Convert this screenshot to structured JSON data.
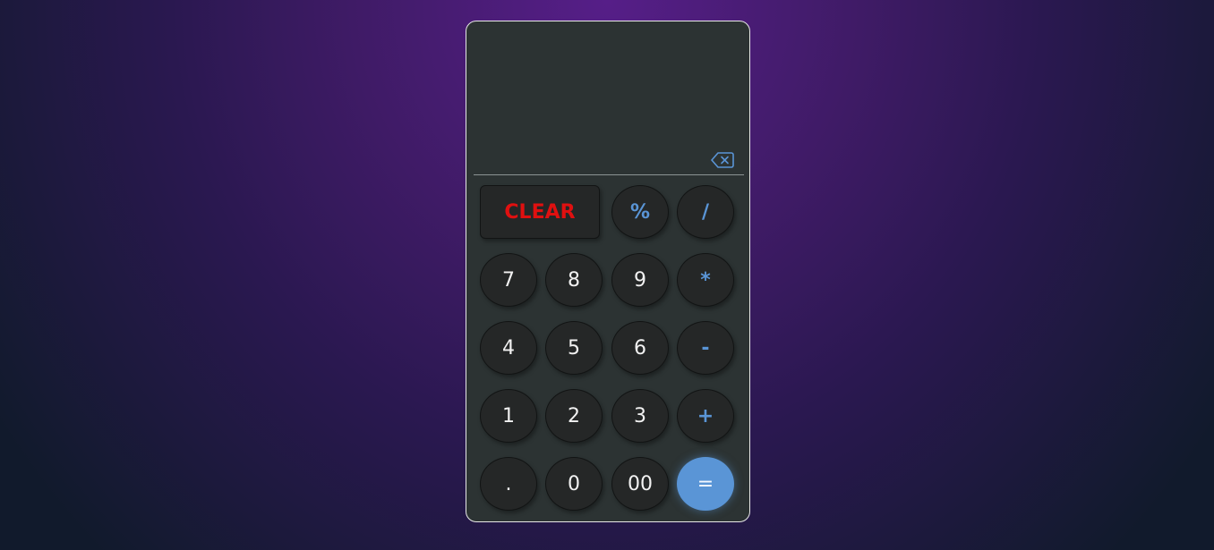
{
  "display": {
    "value": "",
    "backspace_icon": "backspace-icon"
  },
  "keys": {
    "clear": "CLEAR",
    "percent": "%",
    "divide": "/",
    "seven": "7",
    "eight": "8",
    "nine": "9",
    "multiply": "*",
    "four": "4",
    "five": "5",
    "six": "6",
    "subtract": "-",
    "one": "1",
    "two": "2",
    "three": "3",
    "add": "+",
    "decimal": ".",
    "zero": "0",
    "double_zero": "00",
    "equals": "="
  },
  "colors": {
    "accent": "#5a95d6",
    "clear_text": "#e01010",
    "panel": "#2c3333",
    "key_bg": "#252727"
  }
}
